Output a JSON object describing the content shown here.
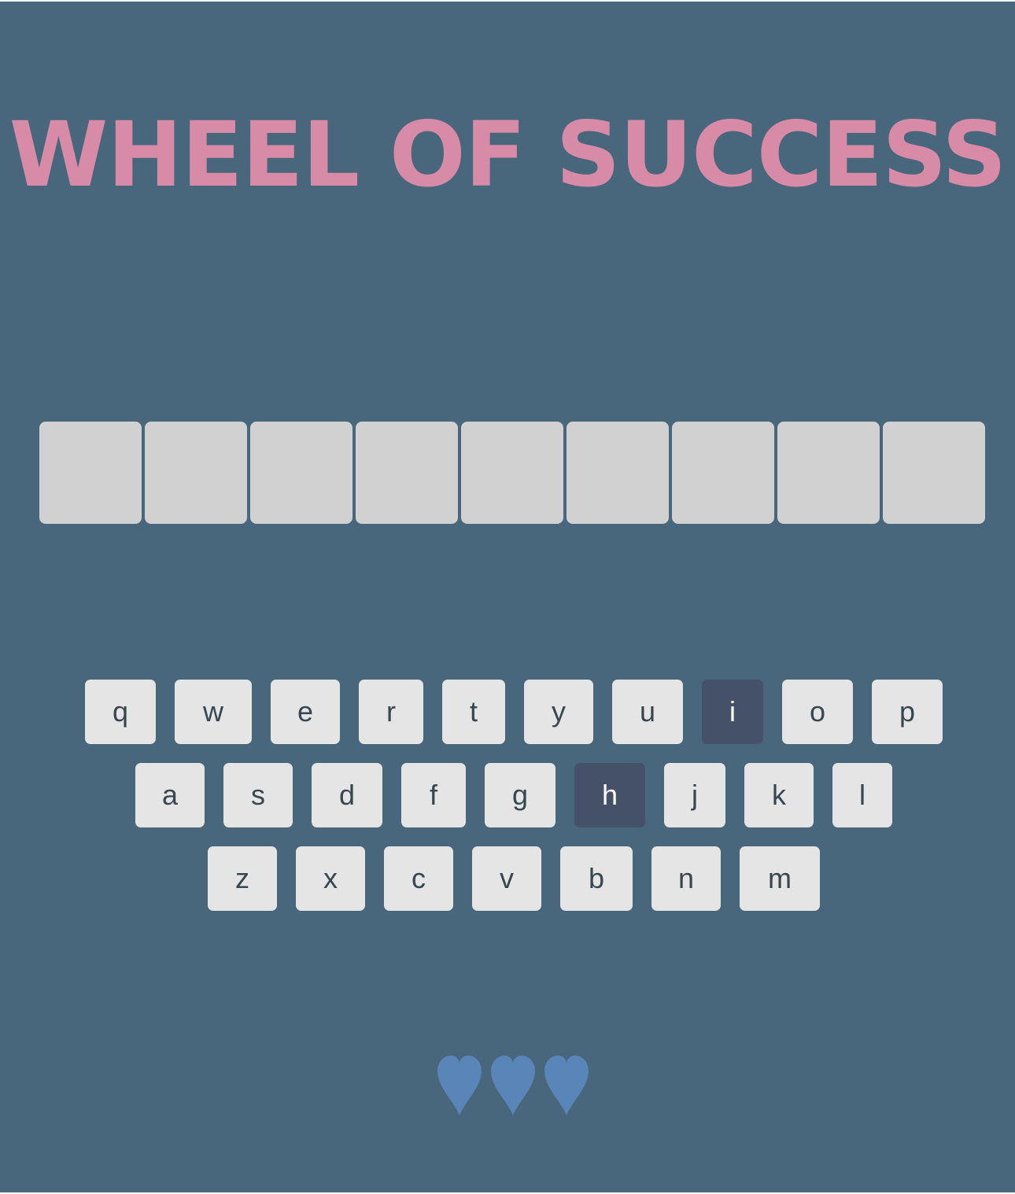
{
  "title": "WHEEL OF SUCCESS",
  "colors": {
    "background": "#48677d",
    "title": "#d78ba6",
    "tile": "#d1d1d2",
    "key": "#e5e5e6",
    "key_text": "#37474f",
    "key_chosen": "#445169",
    "heart": "#5985b9"
  },
  "phrase": {
    "tile_count": 9,
    "letters": [
      "",
      "",
      "",
      "",
      "",
      "",
      "",
      "",
      ""
    ]
  },
  "keyboard": {
    "rows": [
      [
        "q",
        "w",
        "e",
        "r",
        "t",
        "y",
        "u",
        "i",
        "o",
        "p"
      ],
      [
        "a",
        "s",
        "d",
        "f",
        "g",
        "h",
        "j",
        "k",
        "l"
      ],
      [
        "z",
        "x",
        "c",
        "v",
        "b",
        "n",
        "m"
      ]
    ],
    "chosen": [
      "i",
      "h"
    ]
  },
  "lives": {
    "remaining": 3,
    "icon": "heart-icon"
  }
}
